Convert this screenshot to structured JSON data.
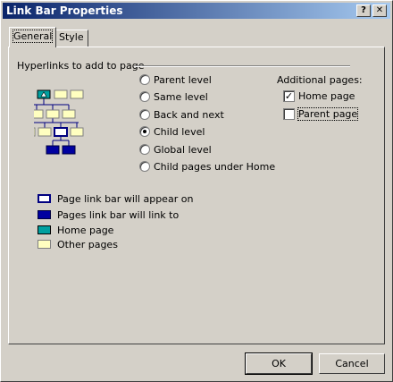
{
  "window": {
    "title": "Link Bar Properties",
    "help": "?",
    "close": "✕"
  },
  "tabs": [
    {
      "label": "General"
    },
    {
      "label": "Style"
    }
  ],
  "group": {
    "title": "Hyperlinks to add to page"
  },
  "radios": [
    {
      "label": "Parent level",
      "selected": false
    },
    {
      "label": "Same level",
      "selected": false
    },
    {
      "label": "Back and next",
      "selected": false
    },
    {
      "label": "Child level",
      "selected": true
    },
    {
      "label": "Global level",
      "selected": false
    },
    {
      "label": "Child pages under Home",
      "selected": false
    }
  ],
  "additional": {
    "title": "Additional pages:",
    "home": {
      "label": "Home page",
      "checked": true
    },
    "parent": {
      "label": "Parent page",
      "checked": false
    }
  },
  "legend": [
    {
      "label": "Page link bar will appear on",
      "icon": "page-appear-icon"
    },
    {
      "label": "Pages link bar will link to",
      "icon": "page-link-icon"
    },
    {
      "label": "Home page",
      "icon": "home-page-icon"
    },
    {
      "label": "Other pages",
      "icon": "other-page-icon"
    }
  ],
  "buttons": {
    "ok": "OK",
    "cancel": "Cancel"
  },
  "colors": {
    "title_start": "#0a246a",
    "title_end": "#a6caf0",
    "link": "#0000a0",
    "other": "#ffffc0",
    "home": "#00a0a0"
  }
}
